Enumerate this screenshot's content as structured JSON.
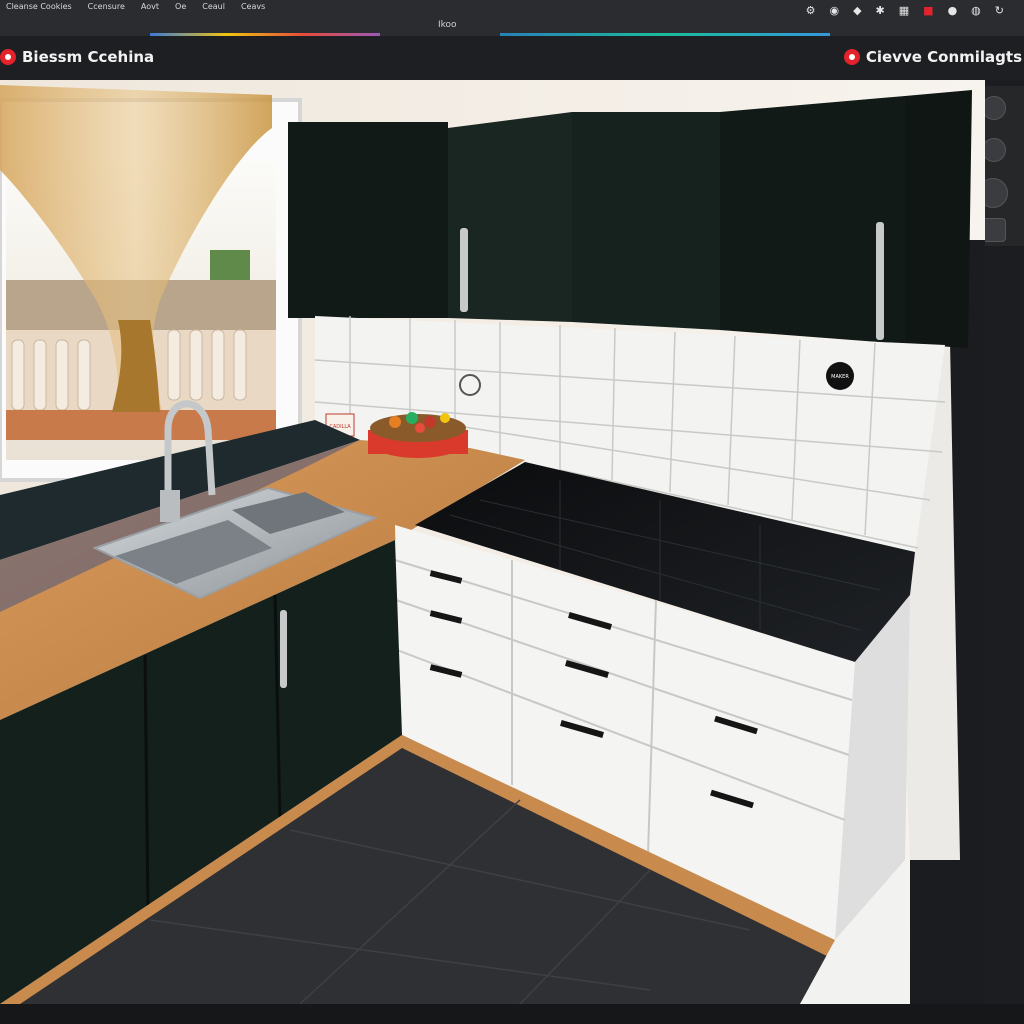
{
  "topbar": {
    "menu": [
      "Cleanse Cookies",
      "Ccensure",
      "Aovt",
      "Oe",
      "Ceaul",
      "Ceavs"
    ],
    "center_label": "Ikoo",
    "toolbar_glyphs": [
      "gear-icon",
      "camera-icon",
      "palette-icon",
      "settings-icon",
      "grid-icon",
      "record-icon",
      "info-icon",
      "help-icon",
      "refresh-icon"
    ]
  },
  "titlebar": {
    "left_title": "Biessm Ccehina",
    "right_title": "Cievve Conmilagts"
  },
  "colors": {
    "cabinet_dark": "#14201c",
    "countertop": "#c98a4e",
    "tile": "#f2f2f0",
    "drawer_white": "#f4f4f2",
    "floor": "#2e3033",
    "accent_red": "#e3232c"
  },
  "photo_labels": {
    "wall_badge": "CADILLA",
    "tile_badge": "MAKER"
  }
}
